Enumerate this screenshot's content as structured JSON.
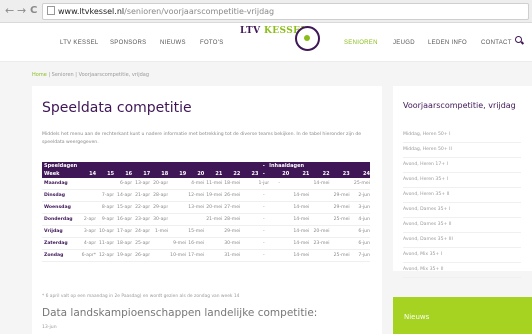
{
  "browser": {
    "back": "←",
    "forward": "→",
    "reload": "C",
    "url_host": "www.ltvkessel.nl",
    "url_path": "/senioren/voorjaarscompetitie-vrijdag"
  },
  "nav": {
    "items": [
      "LTV KESSEL",
      "SPONSORS",
      "NIEUWS",
      "FOTO'S",
      "SENIOREN",
      "JEUGD",
      "LEDEN INFO",
      "CONTACT"
    ],
    "logo_text_a": "LTV",
    "logo_text_b": "KESSEL",
    "active": "SENIOREN"
  },
  "breadcrumb": {
    "home": "Home",
    "sep": "|",
    "section": "Senioren",
    "current": "Voorjaarscompetitie, vrijdag"
  },
  "main": {
    "title": "Speeldata competitie",
    "intro": "Middels het menu aan de rechterkant kunt u nadere informatie met betrekking tot de diverse teams bekijken. In de tabel hieronder zijn de speeldata weergegeven.",
    "table": {
      "header1": [
        "Speeldagen",
        "",
        "",
        "",
        "",
        "",
        "",
        "",
        "",
        "",
        "-",
        "Inhaaldagen",
        "",
        "",
        ""
      ],
      "header2": [
        "Week",
        "14",
        "15",
        "16",
        "17",
        "18",
        "19",
        "20",
        "21",
        "22",
        "23",
        "-",
        "20",
        "21",
        "22",
        "23",
        "24"
      ],
      "rows": [
        [
          "Maandag",
          "",
          "",
          "6-apr",
          "13-apr",
          "20-apr",
          "",
          "4-mei",
          "11-mei",
          "18-mei",
          "",
          "1-jun",
          "-",
          "",
          "14-mei",
          "",
          "25-mei",
          "8-jun"
        ],
        [
          "Dinsdag",
          "",
          "7-apr",
          "14-apr",
          "21-apr",
          "28-apr",
          "",
          "12-mei",
          "19-mei",
          "26-mei",
          "",
          "-",
          "",
          "14-mei",
          "",
          "29-mei",
          "2-jun"
        ],
        [
          "Woensdag",
          "",
          "8-apr",
          "15-apr",
          "22-apr",
          "29-apr",
          "",
          "13-mei",
          "20-mei",
          "27-mei",
          "",
          "-",
          "",
          "14-mei",
          "",
          "29-mei",
          "3-jun"
        ],
        [
          "Donderdag",
          "2-apr",
          "9-apr",
          "16-apr",
          "23-apr",
          "30-apr",
          "",
          "",
          "21-mei",
          "28-mei",
          "",
          "-",
          "",
          "14-mei",
          "",
          "25-mei",
          "4-jun"
        ],
        [
          "Vrijdag",
          "3-apr",
          "10-apr",
          "17-apr",
          "24-apr",
          "1-mei",
          "",
          "15-mei",
          "",
          "29-mei",
          "",
          "-",
          "",
          "14-mei",
          "20-mei",
          "",
          "6-jun"
        ],
        [
          "Zaterdag",
          "4-apr",
          "11-apr",
          "18-apr",
          "25-apr",
          "",
          "9-mei",
          "16-mei",
          "",
          "30-mei",
          "",
          "-",
          "",
          "14-mei",
          "23-mei",
          "",
          "6-jun"
        ],
        [
          "Zondag",
          "6-apr*",
          "12-apr",
          "19-apr",
          "26-apr",
          "",
          "10-mei",
          "17-mei",
          "",
          "31-mei",
          "",
          "-",
          "",
          "14-mei",
          "",
          "25-mei",
          "7-jun"
        ]
      ]
    },
    "note": "* 6 april valt op een maandag in 2e Paasdag) en wordt gezien als de zondag van week 14",
    "subtitle": "Data landskampioenschappen landelijke competitie:",
    "subtitle_small": "13-jun"
  },
  "sidebar": {
    "title": "Voorjaarscompetitie, vrijdag",
    "items": [
      "Middag, Heren 50+ I",
      "Middag, Heren 50+ II",
      "Avond, Heren 17+ I",
      "Avond, Heren 35+ I",
      "Avond, Heren 35+ II",
      "Avond, Dames 35+ I",
      "Avond, Dames 35+ II",
      "Avond, Dames 35+ III",
      "Avond, Mix 35+ I",
      "Avond, Mix 35+ II"
    ],
    "news_title": "Nieuws"
  },
  "colors": {
    "brand_purple": "#3f1757",
    "brand_green": "#8bbd1a",
    "news_green": "#a6d221"
  }
}
